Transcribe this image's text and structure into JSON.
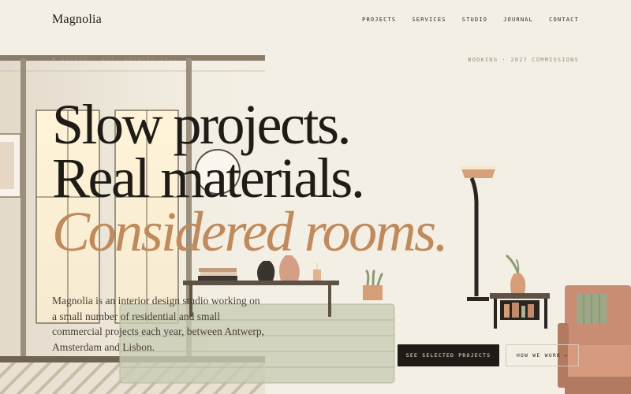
{
  "nav": {
    "brand": "Magnolia",
    "items": [
      {
        "label": "PROJECTS"
      },
      {
        "label": "SERVICES"
      },
      {
        "label": "STUDIO"
      },
      {
        "label": "JOURNAL"
      },
      {
        "label": "CONTACT"
      }
    ]
  },
  "hero": {
    "eyebrow_left": "● STUDIO · EST. ANTWERP 2012",
    "eyebrow_right": "BOOKING · 2027 COMMISSIONS",
    "headline": {
      "line1": "Slow projects.",
      "line2": "Real materials.",
      "line3": "Considered rooms."
    },
    "intro": "Magnolia is an interior design studio working on a small number of residential and small commercial projects each year, between Antwerp, Amsterdam and Lisbon.",
    "cta_primary": "SEE SELECTED PROJECTS",
    "cta_secondary": "HOW WE WORK",
    "cta_secondary_icon": "→"
  },
  "colors": {
    "background": "#f4efe4",
    "ink": "#1f1b16",
    "accent": "#c08a5c",
    "muted": "#9a8f80"
  }
}
